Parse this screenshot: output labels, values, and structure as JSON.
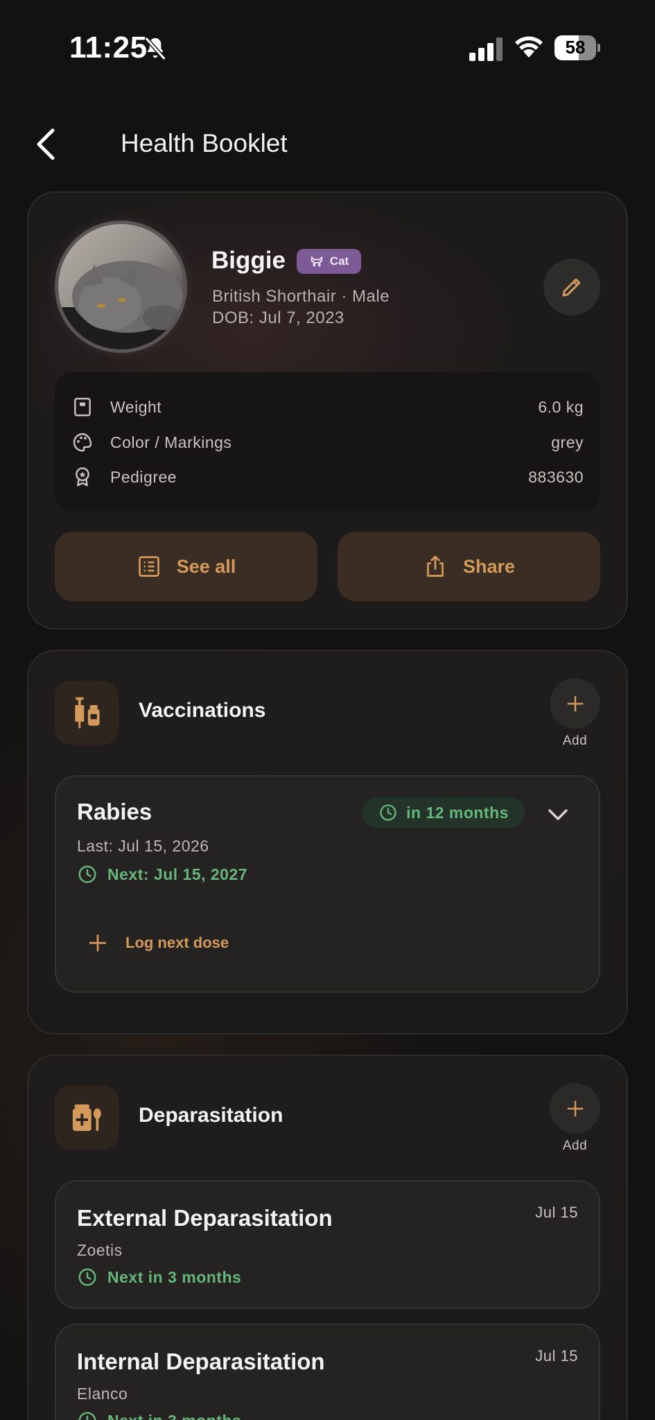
{
  "status_bar": {
    "time": "11:25",
    "battery": "58",
    "battery_level": 0.58
  },
  "header": {
    "title": "Health Booklet"
  },
  "pet": {
    "name": "Biggie",
    "species_badge": "Cat",
    "breed_sex": "British Shorthair · Male",
    "dob": "DOB: Jul 7, 2023"
  },
  "details": [
    {
      "icon": "scale-icon",
      "label": "Weight",
      "value": "6.0 kg"
    },
    {
      "icon": "palette-icon",
      "label": "Color / Markings",
      "value": "grey"
    },
    {
      "icon": "award-icon",
      "label": "Pedigree",
      "value": "883630"
    }
  ],
  "actions": {
    "see_all": "See all",
    "share": "Share"
  },
  "vaccinations": {
    "title": "Vaccinations",
    "add_label": "Add",
    "items": [
      {
        "name": "Rabies",
        "due_pill": "in 12 months",
        "last": "Last: Jul 15, 2026",
        "next": "Next: Jul 15, 2027",
        "log_next": "Log next dose"
      }
    ]
  },
  "deparasitation": {
    "title": "Deparasitation",
    "add_label": "Add",
    "items": [
      {
        "name": "External Deparasitation",
        "date": "Jul 15",
        "brand": "Zoetis",
        "next": "Next in 3 months"
      },
      {
        "name": "Internal Deparasitation",
        "date": "Jul 15",
        "brand": "Elanco",
        "next": "Next in 3 months"
      }
    ]
  },
  "colors": {
    "accent": "#d49a5c",
    "success": "#66b679",
    "badge": "#7c5a96",
    "background": "#121212"
  }
}
